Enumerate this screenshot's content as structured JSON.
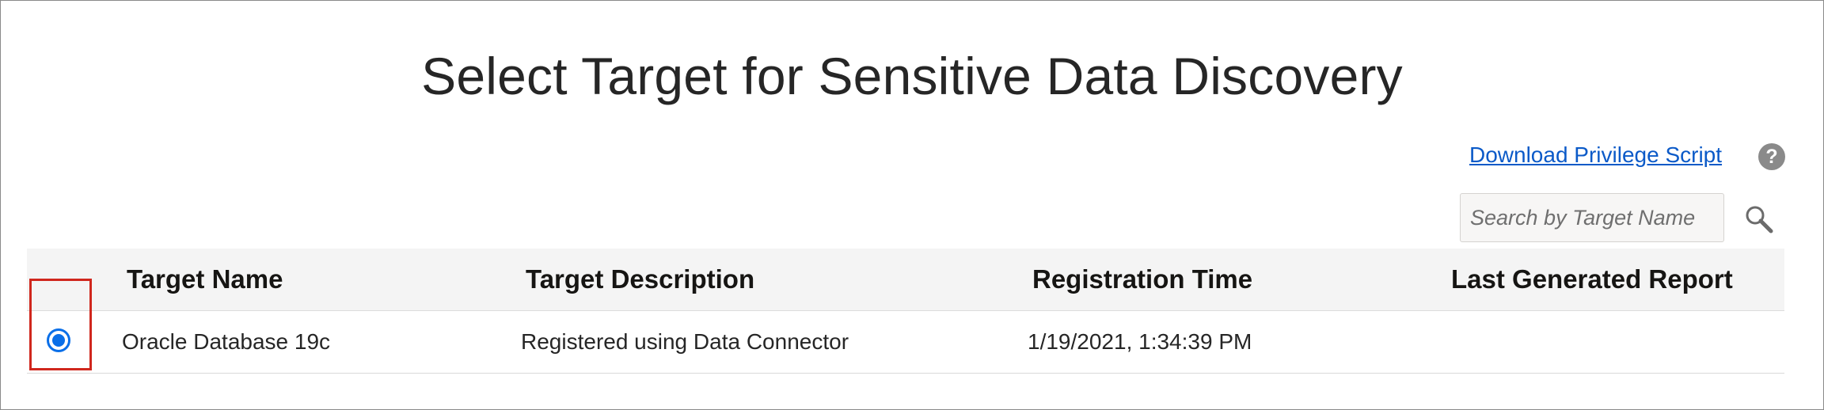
{
  "page": {
    "title": "Select Target for Sensitive Data Discovery"
  },
  "toolbar": {
    "download_link": "Download Privilege Script",
    "help_icon": "help-icon",
    "help_glyph": "?"
  },
  "search": {
    "placeholder": "Search by Target Name",
    "value": "",
    "icon": "search-icon"
  },
  "table": {
    "columns": [
      "Target Name",
      "Target Description",
      "Registration Time",
      "Last Generated Report"
    ],
    "rows": [
      {
        "selected": true,
        "target_name": "Oracle Database 19c",
        "target_description": "Registered using Data Connector",
        "registration_time": "1/19/2021, 1:34:39 PM",
        "last_generated_report": ""
      }
    ]
  },
  "colors": {
    "link": "#0b5ac8",
    "accent": "#0a6fe8",
    "highlight_box": "#d0271d",
    "header_bg": "#f4f4f4"
  }
}
